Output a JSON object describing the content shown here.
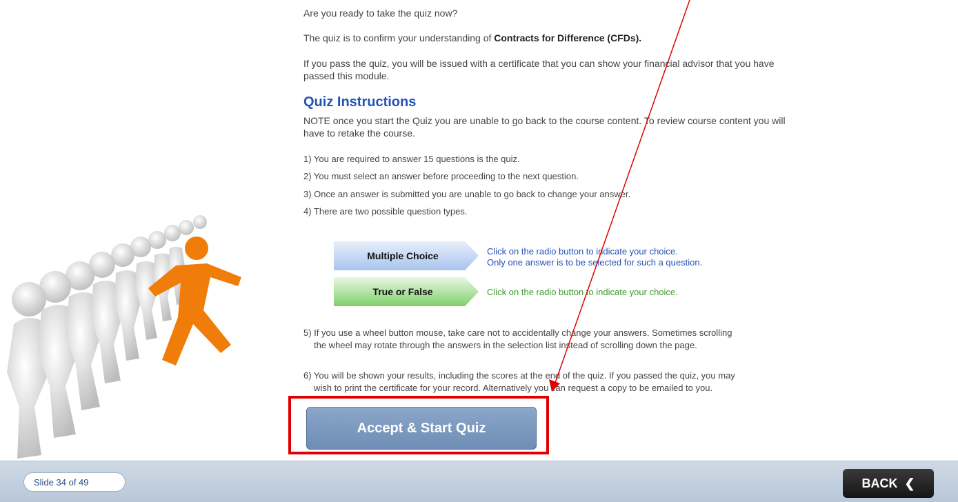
{
  "intro": {
    "line1": "Are you ready to take the quiz now?",
    "line2_prefix": "The quiz is to confirm your understanding of ",
    "line2_bold": "Contracts for Difference (CFDs).",
    "line3a": "If you pass the quiz, you will be issued with a certificate that you can show your financial advisor that you have",
    "line3b": "passed this module."
  },
  "instructions": {
    "heading": "Quiz Instructions",
    "note_a": "NOTE once you start the Quiz you are unable to go back to the course content. To review course content you will",
    "note_b": "have to retake the course.",
    "rules": [
      "1)  You are required to answer 15 questions is the quiz.",
      "2)  You must select an answer before proceeding to the next question.",
      "3)  Once an answer is submitted you are unable to go back to change your answer.",
      "4)  There are two possible question types."
    ],
    "question_types": [
      {
        "label": "Multiple Choice",
        "desc_a": "Click on the radio button to indicate your choice.",
        "desc_b": "Only one answer is to be selected for such a question.",
        "color": "#2452b5"
      },
      {
        "label": "True or False",
        "desc_a": "Click on the radio button to indicate your choice.",
        "color": "#3c9a2c"
      }
    ],
    "rule5a": "5)  If you use a wheel button mouse, take care not to accidentally change your answers. Sometimes scrolling",
    "rule5b": "the wheel may rotate through the answers in the selection list instead of scrolling down the page.",
    "rule6a": "6)  You will be shown your results, including the scores at the end of the quiz. If you passed the quiz, you may",
    "rule6b": "wish to print the certificate for your record. Alternatively you can request a copy to be emailed to you."
  },
  "accept_button": "Accept & Start Quiz",
  "footer": {
    "slide_counter": "Slide 34 of 49",
    "back_label": "BACK",
    "back_icon": "chevron-left-icon"
  },
  "colors": {
    "accent": "#2452b5",
    "highlight": "#e00000",
    "runner": "#f07d0a"
  }
}
